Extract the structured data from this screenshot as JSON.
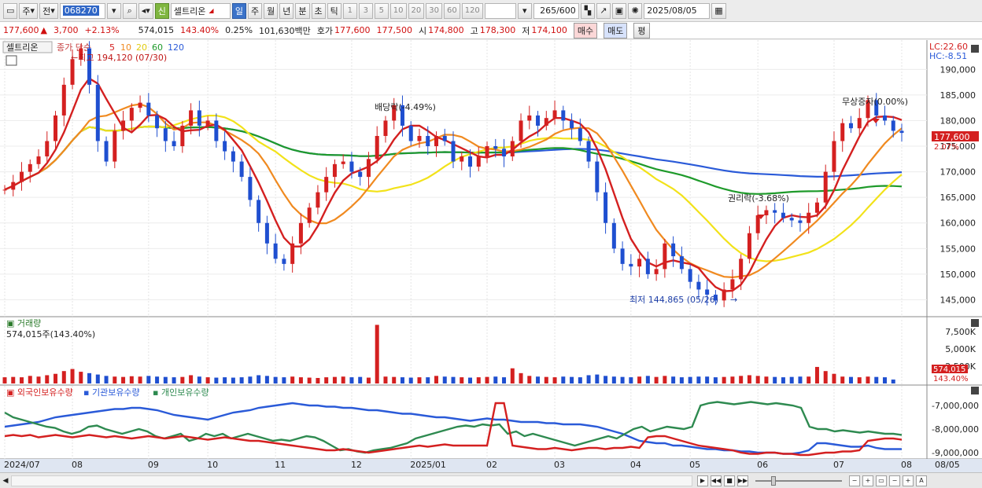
{
  "toolbar": {
    "type": "주",
    "prefix": "전",
    "code": "068270",
    "stock_name": "셀트리온",
    "badge": "신",
    "periods": [
      "일",
      "주",
      "월",
      "년",
      "분",
      "초",
      "틱"
    ],
    "nums": [
      "1",
      "3",
      "5",
      "10",
      "20",
      "30",
      "60",
      "120"
    ],
    "count": "265",
    "count_total": "/600",
    "date": "2025/08/05"
  },
  "quote": {
    "price": "177,600",
    "change": "3,700",
    "change_pct": "+2.13%",
    "volume": "574,015",
    "vol_pct": "143.40%",
    "turnover": "0.25%",
    "amount": "101,630백만",
    "hoga_label": "호가",
    "ask": "177,600",
    "bid": "177,500",
    "open_label": "시",
    "open": "174,800",
    "high_label": "고",
    "high": "178,300",
    "low_label": "저",
    "low": "174,100",
    "buy": "매수",
    "sell": "매도",
    "avg": "평"
  },
  "main": {
    "tab": "셀트리온",
    "legend_prefix": "종가 단순",
    "ma_labels": [
      "5",
      "10",
      "20",
      "60",
      "120"
    ],
    "ma_colors": [
      "#d42020",
      "#f08a20",
      "#f2e21a",
      "#1e9a2a",
      "#2a5ad8"
    ],
    "lc": "LC:22.60",
    "hc": "HC:-8.51",
    "y_ticks": [
      "190,000",
      "185,000",
      "180,000",
      "175,000",
      "170,000",
      "165,000",
      "160,000",
      "155,000",
      "150,000",
      "145,000"
    ],
    "high_annot": "←최고 194,120 (07/30)",
    "low_annot": "최저 144,865 (05/26)",
    "ann1": "배당락(-4.49%)",
    "ann2": "권리락(-3.68%)",
    "ann3": "무상증자(0.00%)",
    "cur_price": "177,600",
    "cur_pct": "2.07%"
  },
  "volume_panel": {
    "title": "거래량",
    "value": "574,015주(143.40%)",
    "y_ticks": [
      "7,500K",
      "5,000K",
      "2,500K"
    ],
    "cur": "574,015",
    "cur_pct": "143.40%"
  },
  "holding_panel": {
    "labels": [
      "외국인보유수량",
      "기관보유수량",
      "개인보유수량"
    ],
    "y_ticks": [
      "-7,000,000",
      "-8,000,000",
      "-9,000,000"
    ]
  },
  "xaxis": {
    "ticks": [
      "2024/07",
      "08",
      "09",
      "10",
      "11",
      "12",
      "2025/01",
      "02",
      "03",
      "04",
      "05",
      "06",
      "07",
      "08"
    ],
    "right": "08/05"
  },
  "chart_data": {
    "type": "line",
    "y_range": [
      142000,
      194500
    ],
    "prices": [
      166500,
      168000,
      170000,
      171500,
      173000,
      176000,
      181000,
      187000,
      192000,
      194120,
      187000,
      176000,
      172000,
      178000,
      180000,
      182500,
      183500,
      181000,
      178500,
      176000,
      175000,
      179000,
      182000,
      179000,
      180000,
      176000,
      174000,
      172000,
      169000,
      164500,
      160000,
      156000,
      153000,
      152000,
      156000,
      160000,
      163000,
      166000,
      169000,
      171500,
      172000,
      170000,
      169000,
      172500,
      177000,
      180000,
      183000,
      179000,
      176000,
      177000,
      175000,
      177000,
      176000,
      172000,
      173000,
      171000,
      173000,
      175000,
      174500,
      173000,
      176000,
      180000,
      181000,
      179000,
      180500,
      182000,
      180000,
      178500,
      176000,
      172000,
      166000,
      160000,
      155000,
      152000,
      151500,
      153000,
      150000,
      151000,
      156000,
      153500,
      151000,
      148500,
      147000,
      146000,
      144865,
      147000,
      149000,
      153000,
      158000,
      161500,
      162500,
      162000,
      161000,
      160500,
      160000,
      162000,
      164000,
      170000,
      176000,
      179500,
      178500,
      180500,
      184000,
      181000,
      180000,
      178000,
      177600
    ],
    "volumes": [
      900,
      950,
      900,
      1100,
      1000,
      1200,
      1400,
      1800,
      2100,
      1700,
      1500,
      1300,
      1100,
      1000,
      950,
      1050,
      1000,
      1100,
      1000,
      950,
      900,
      950,
      1200,
      1000,
      900,
      850,
      900,
      850,
      900,
      1000,
      1200,
      1100,
      950,
      900,
      1000,
      900,
      850,
      800,
      900,
      950,
      1000,
      900,
      950,
      850,
      8500,
      1000,
      950,
      900,
      850,
      900,
      900,
      1100,
      1000,
      950,
      900,
      850,
      900,
      950,
      1000,
      900,
      2200,
      1500,
      1100,
      1000,
      950,
      900,
      1000,
      950,
      900,
      1200,
      1300,
      1100,
      1000,
      950,
      900,
      1000,
      1100,
      950,
      1100,
      1000,
      900,
      950,
      1000,
      1000,
      900,
      950,
      1000,
      1100,
      1200,
      1100,
      1000,
      950,
      900,
      950,
      1000,
      1000,
      2400,
      1800,
      1400,
      1000,
      950,
      900,
      1000,
      950,
      900,
      574
    ],
    "foreign": [
      -8.3,
      -8.25,
      -8.3,
      -8.25,
      -8.35,
      -8.3,
      -8.25,
      -8.3,
      -8.35,
      -8.3,
      -8.25,
      -8.3,
      -8.35,
      -8.3,
      -8.35,
      -8.4,
      -8.35,
      -8.3,
      -8.35,
      -8.4,
      -8.35,
      -8.3,
      -8.35,
      -8.4,
      -8.45,
      -8.4,
      -8.35,
      -8.4,
      -8.45,
      -8.5,
      -8.5,
      -8.55,
      -8.6,
      -8.65,
      -8.7,
      -8.75,
      -8.8,
      -8.85,
      -8.9,
      -8.9,
      -8.85,
      -8.9,
      -8.95,
      -9.0,
      -8.95,
      -8.9,
      -8.85,
      -8.8,
      -8.75,
      -8.7,
      -8.75,
      -8.7,
      -8.65,
      -8.7,
      -8.7,
      -8.7,
      -8.7,
      -8.7,
      -6.9,
      -6.9,
      -8.7,
      -8.75,
      -8.8,
      -8.85,
      -8.85,
      -8.8,
      -8.85,
      -8.9,
      -8.85,
      -8.8,
      -8.8,
      -8.85,
      -8.8,
      -8.8,
      -8.75,
      -8.8,
      -8.35,
      -8.3,
      -8.3,
      -8.4,
      -8.5,
      -8.6,
      -8.7,
      -8.75,
      -8.8,
      -8.85,
      -8.9,
      -9.0,
      -9.05,
      -9.05,
      -9.0,
      -9.0,
      -9.05,
      -9.05,
      -9.1,
      -9.1,
      -9.05,
      -9.0,
      -9.0,
      -8.95,
      -8.95,
      -8.9,
      -8.5,
      -8.45,
      -8.4,
      -8.4,
      -8.45
    ],
    "institution": [
      -7.9,
      -7.85,
      -7.8,
      -7.75,
      -7.7,
      -7.6,
      -7.5,
      -7.45,
      -7.4,
      -7.35,
      -7.3,
      -7.25,
      -7.2,
      -7.15,
      -7.15,
      -7.1,
      -7.1,
      -7.15,
      -7.2,
      -7.3,
      -7.4,
      -7.45,
      -7.5,
      -7.55,
      -7.6,
      -7.5,
      -7.4,
      -7.3,
      -7.25,
      -7.2,
      -7.1,
      -7.05,
      -7.0,
      -6.95,
      -6.9,
      -6.95,
      -7.0,
      -7.0,
      -7.05,
      -7.05,
      -7.1,
      -7.1,
      -7.15,
      -7.2,
      -7.2,
      -7.25,
      -7.3,
      -7.35,
      -7.35,
      -7.4,
      -7.45,
      -7.5,
      -7.5,
      -7.55,
      -7.6,
      -7.65,
      -7.6,
      -7.55,
      -7.6,
      -7.6,
      -7.65,
      -7.7,
      -7.7,
      -7.7,
      -7.75,
      -7.75,
      -7.8,
      -7.8,
      -7.8,
      -7.85,
      -7.9,
      -8.0,
      -8.1,
      -8.2,
      -8.35,
      -8.5,
      -8.55,
      -8.6,
      -8.6,
      -8.7,
      -8.7,
      -8.75,
      -8.8,
      -8.85,
      -8.85,
      -8.9,
      -8.9,
      -8.95,
      -8.95,
      -9.0,
      -9.0,
      -9.0,
      -9.05,
      -9.05,
      -9.0,
      -8.9,
      -8.6,
      -8.6,
      -8.65,
      -8.7,
      -8.75,
      -8.75,
      -8.7,
      -8.8,
      -8.85,
      -8.85,
      -8.85
    ],
    "individual": [
      -7.3,
      -7.5,
      -7.6,
      -7.7,
      -7.8,
      -7.9,
      -7.95,
      -8.1,
      -8.2,
      -8.1,
      -7.9,
      -7.85,
      -8.0,
      -8.1,
      -8.2,
      -8.1,
      -8.0,
      -8.1,
      -8.3,
      -8.4,
      -8.3,
      -8.2,
      -8.5,
      -8.4,
      -8.2,
      -8.3,
      -8.2,
      -8.4,
      -8.3,
      -8.2,
      -8.3,
      -8.4,
      -8.5,
      -8.45,
      -8.5,
      -8.4,
      -8.3,
      -8.35,
      -8.5,
      -8.7,
      -8.9,
      -8.85,
      -8.95,
      -9.0,
      -8.9,
      -8.85,
      -8.8,
      -8.7,
      -8.6,
      -8.4,
      -8.3,
      -8.2,
      -8.1,
      -8.0,
      -7.9,
      -7.85,
      -7.9,
      -7.8,
      -7.85,
      -7.8,
      -8.2,
      -8.1,
      -8.3,
      -8.2,
      -8.3,
      -8.4,
      -8.5,
      -8.6,
      -8.7,
      -8.6,
      -8.5,
      -8.4,
      -8.3,
      -8.4,
      -8.2,
      -8.0,
      -7.9,
      -8.1,
      -8.0,
      -7.9,
      -7.95,
      -8.0,
      -7.9,
      -7.0,
      -6.9,
      -6.85,
      -6.9,
      -6.95,
      -6.9,
      -6.85,
      -6.9,
      -6.95,
      -6.9,
      -6.95,
      -7.0,
      -7.1,
      -7.9,
      -8.0,
      -8.0,
      -8.1,
      -8.05,
      -8.1,
      -8.15,
      -8.1,
      -8.15,
      -8.2,
      -8.2,
      -8.25
    ]
  }
}
